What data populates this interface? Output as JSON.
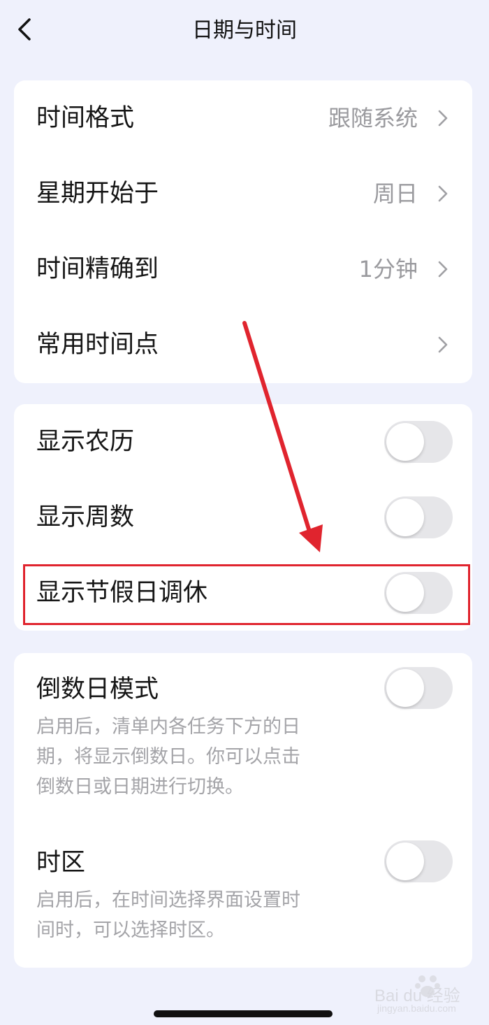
{
  "header": {
    "title": "日期与时间"
  },
  "card1": {
    "rows": [
      {
        "label": "时间格式",
        "value": "跟随系统"
      },
      {
        "label": "星期开始于",
        "value": "周日"
      },
      {
        "label": "时间精确到",
        "value": "1分钟"
      },
      {
        "label": "常用时间点",
        "value": ""
      }
    ]
  },
  "card2": {
    "rows": [
      {
        "label": "显示农历",
        "enabled": false
      },
      {
        "label": "显示周数",
        "enabled": false
      },
      {
        "label": "显示节假日调休",
        "enabled": false
      }
    ]
  },
  "card3": {
    "rows": [
      {
        "label": "倒数日模式",
        "enabled": false,
        "desc_lines": [
          "启用后，清单内各任务下方的日",
          "期，将显示倒数日。你可以点击",
          "倒数日或日期进行切换。"
        ]
      },
      {
        "label": "时区",
        "enabled": false,
        "desc_lines": [
          "启用后，在时间选择界面设置时",
          "间时，可以选择时区。"
        ]
      }
    ]
  },
  "watermark": {
    "brand": "Bai du 经验",
    "url": "jingyan.baidu.com"
  },
  "colors": {
    "background": "#eff1fc",
    "card": "#ffffff",
    "annotation": "#e0242e",
    "toggle_off": "#e6e6e9"
  }
}
